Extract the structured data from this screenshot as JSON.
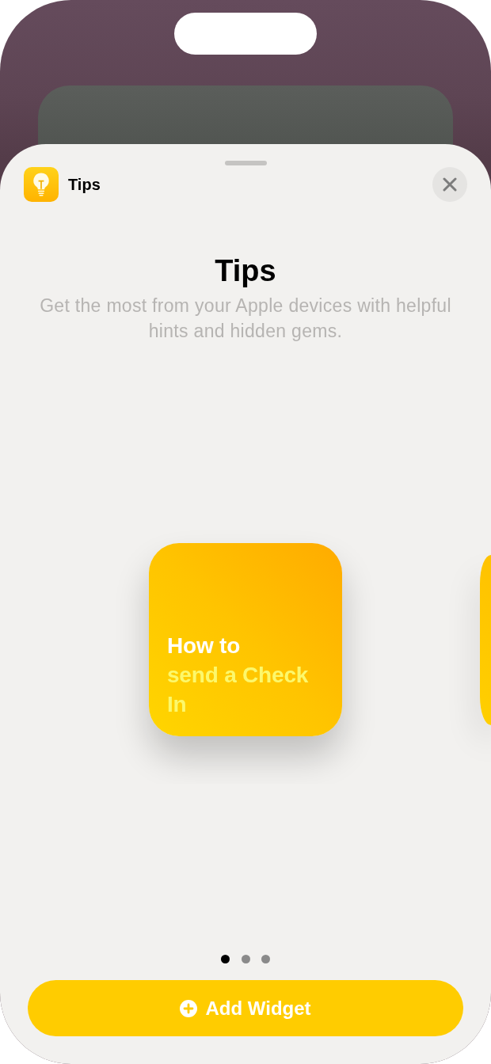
{
  "app": {
    "name": "Tips"
  },
  "sheet": {
    "title": "Tips",
    "description": "Get the most from your Apple devices with helpful hints and hidden gems."
  },
  "widgets": [
    {
      "kind": "full",
      "title": [
        {
          "text": "How to",
          "highlighted": false
        },
        {
          "text": "send a Check In",
          "highlighted": true
        }
      ]
    },
    {
      "kind": "peek"
    }
  ],
  "pages": [
    {
      "selected": true
    },
    {
      "selected": false
    },
    {
      "selected": false
    }
  ],
  "add_button": {
    "label": "Add Widget"
  }
}
